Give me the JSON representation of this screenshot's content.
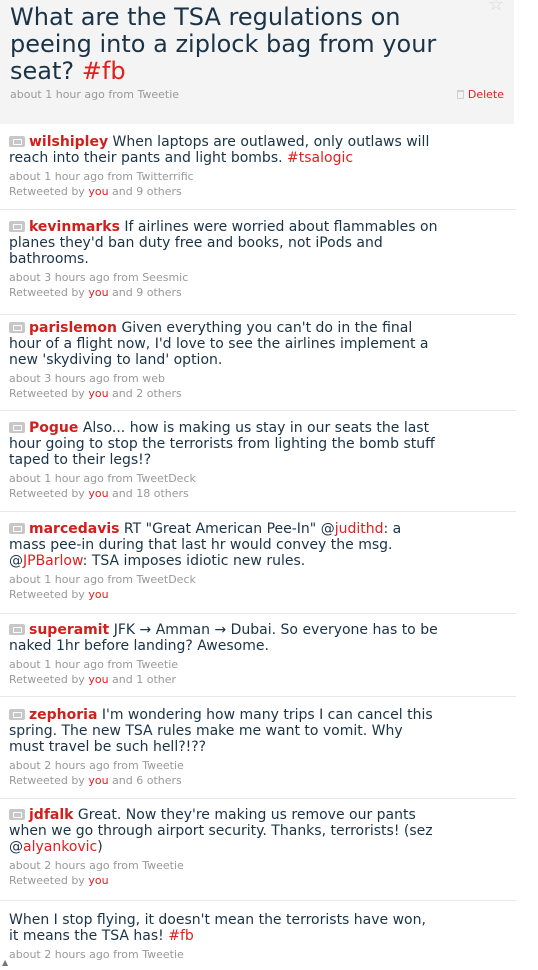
{
  "header": {
    "title": "What are the TSA regulations on peeing into a ziplock bag from your seat?",
    "hashtag": "#fb",
    "meta": "about 1 hour ago from Tweetie",
    "delete_label": "Delete",
    "star_icon": "star-icon",
    "trash_icon": "trash-icon"
  },
  "tweets": [
    {
      "user": "wilshipley",
      "text": "When laptops are outlawed, only outlaws will reach into their pants and light bombs.",
      "hashtag": "#tsalogic",
      "time": "about 1 hour ago from Twitterrific",
      "retweeted_prefix": "Retweeted by",
      "you": "you",
      "others": "and 9 others"
    },
    {
      "user": "kevinmarks",
      "text": "If airlines were worried about flammables on planes they'd ban duty free and books, not iPods and bathrooms.",
      "time": "about 3 hours ago from Seesmic",
      "retweeted_prefix": "Retweeted by",
      "you": "you",
      "others": "and 9 others"
    },
    {
      "user": "parislemon",
      "text": "Given everything you can't do in the final hour of a flight now, I'd love to see the airlines implement a new 'skydiving to land' option.",
      "time": "about 3 hours ago from web",
      "retweeted_prefix": "Retweeted by",
      "you": "you",
      "others": "and 2 others"
    },
    {
      "user": "Pogue",
      "text": "Also... how is making us stay in our seats the last hour going to stop the terrorists from lighting the bomb stuff taped to their legs!?",
      "time": "about 1 hour ago from TweetDeck",
      "retweeted_prefix": "Retweeted by",
      "you": "you",
      "others": "and 18 others"
    },
    {
      "user": "marcedavis",
      "text_a": "RT \"Great American Pee-In\" @",
      "mention_a": "judithd",
      "text_b": ": a mass pee-in during that last hr would convey the msg. @",
      "mention_b": "JPBarlow",
      "text_c": ": TSA imposes idiotic new rules.",
      "time": "about 1 hour ago from TweetDeck",
      "retweeted_prefix": "Retweeted by",
      "you": "you"
    },
    {
      "user": "superamit",
      "text": "JFK → Amman → Dubai. So everyone has to be naked 1hr before landing? Awesome.",
      "time": "about 1 hour ago from Tweetie",
      "retweeted_prefix": "Retweeted by",
      "you": "you",
      "others": "and 1 other"
    },
    {
      "user": "zephoria",
      "text": "I'm wondering how many trips I can cancel this spring. The new TSA rules make me want to vomit. Why must travel be such hell?!??",
      "time": "about 2 hours ago from Tweetie",
      "retweeted_prefix": "Retweeted by",
      "you": "you",
      "others": "and 6 others"
    },
    {
      "user": "jdfalk",
      "text_a": "Great. Now they're making us remove our pants when we go through airport security. Thanks, terrorists! (sez @",
      "mention_a": "alyankovic",
      "text_b": ")",
      "time": "about 2 hours ago from Tweetie",
      "retweeted_prefix": "Retweeted by",
      "you": "you"
    },
    {
      "text": "When I stop flying, it doesn't mean the terrorists have won, it means the TSA has!",
      "hashtag": "#fb",
      "time": "about 2 hours ago from Tweetie"
    }
  ],
  "scroll_glyph": "▲"
}
